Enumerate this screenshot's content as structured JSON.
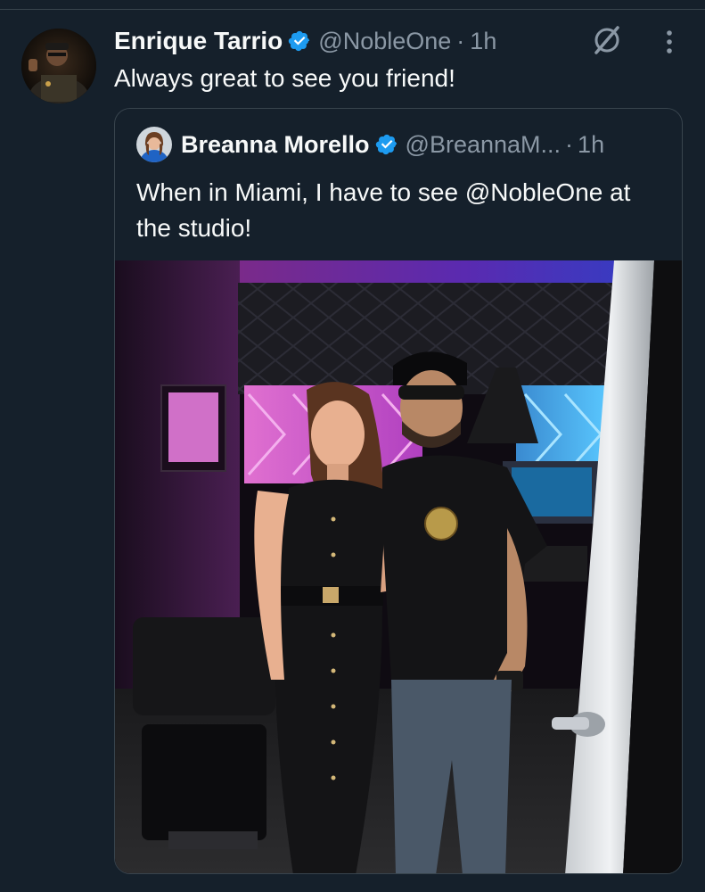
{
  "tweet": {
    "author_name": "Enrique Tarrio",
    "author_handle": "@NobleOne",
    "separator": "·",
    "time": "1h",
    "text": "Always great to see you friend!"
  },
  "quoted_tweet": {
    "author_name": "Breanna Morello",
    "author_handle": "@BreannaM...",
    "separator": "·",
    "time": "1h",
    "text": "When in Miami, I have to see @NobleOne at the studio!"
  },
  "icons": {
    "verified": "verified-badge-icon",
    "grok": "grok-icon",
    "more": "more-options-icon"
  },
  "colors": {
    "background": "#15202b",
    "border": "#38444d",
    "secondary_text": "#8b98a5",
    "verified_blue": "#1d9bf0"
  }
}
